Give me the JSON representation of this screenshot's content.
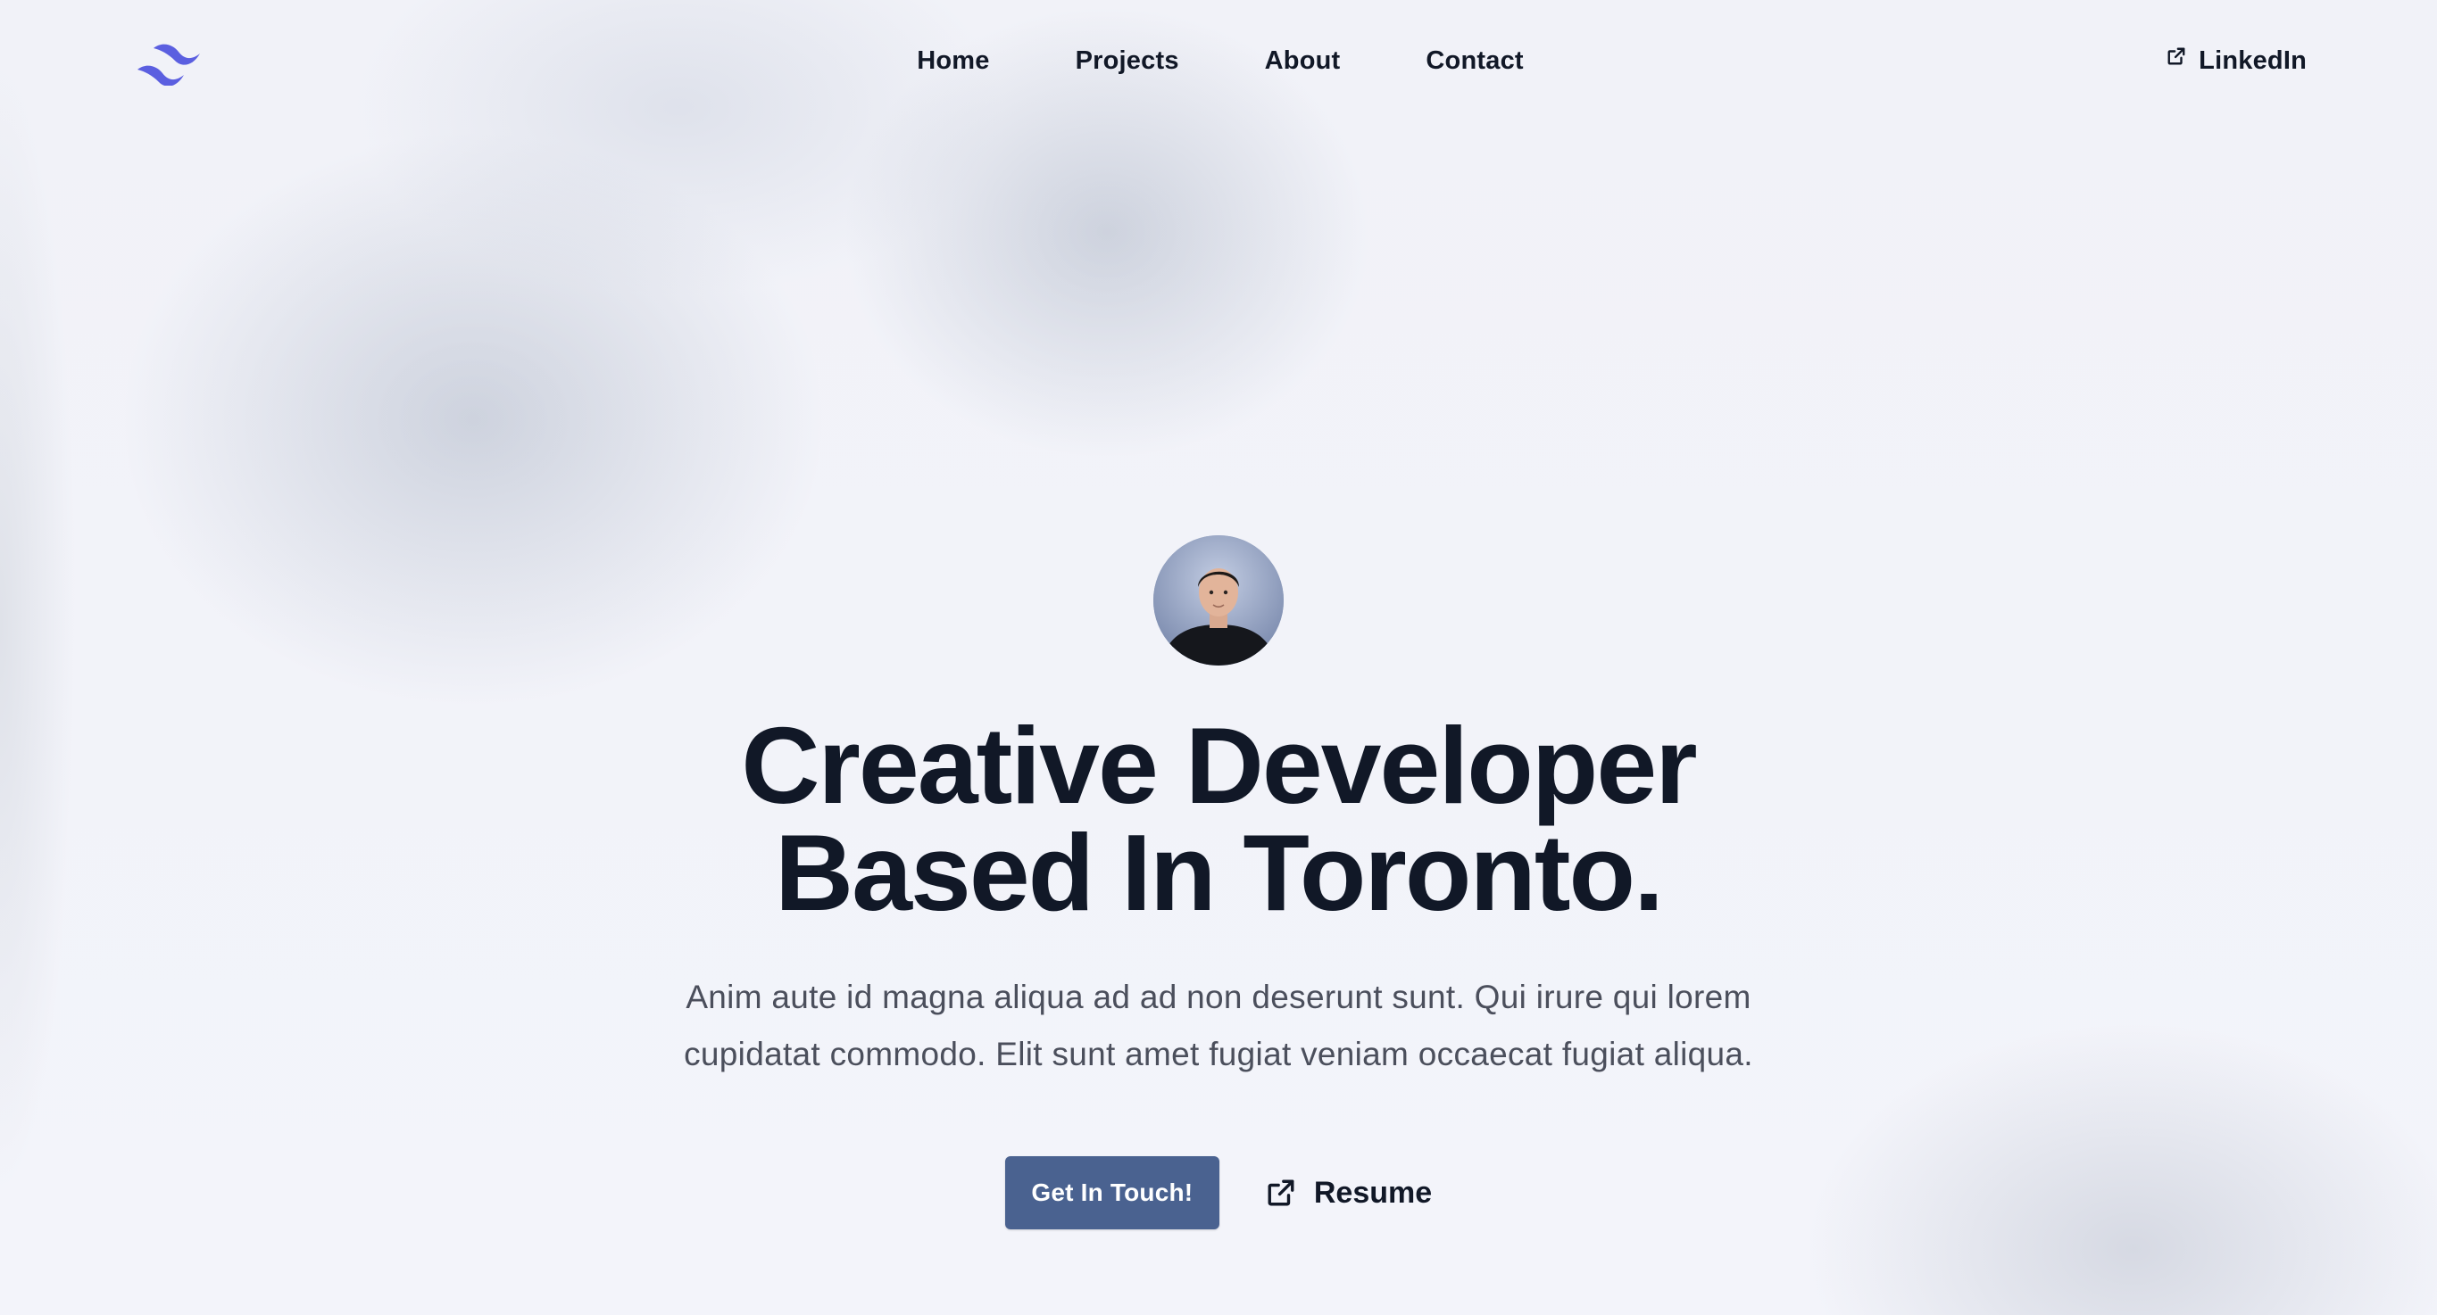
{
  "nav": {
    "logo_icon": "tailwind-wave-logo",
    "links": [
      {
        "label": "Home"
      },
      {
        "label": "Projects"
      },
      {
        "label": "About"
      },
      {
        "label": "Contact"
      }
    ],
    "external": {
      "label": "LinkedIn",
      "icon": "external-link-icon"
    }
  },
  "hero": {
    "avatar_icon": "profile-photo",
    "headline_line1": "Creative Developer",
    "headline_line2": "Based In Toronto.",
    "subtext": "Anim aute id magna aliqua ad ad non deserunt sunt. Qui irure qui lorem cupidatat commodo. Elit sunt amet fugiat veniam occaecat fugiat aliqua.",
    "primary_cta": "Get In Touch!",
    "secondary_cta": {
      "label": "Resume",
      "icon": "external-link-icon"
    }
  },
  "colors": {
    "accent": "#4a6290",
    "logo": "#5b5fe0",
    "text": "#111827",
    "muted": "#4b4f5c",
    "background": "#f2f3f9"
  }
}
